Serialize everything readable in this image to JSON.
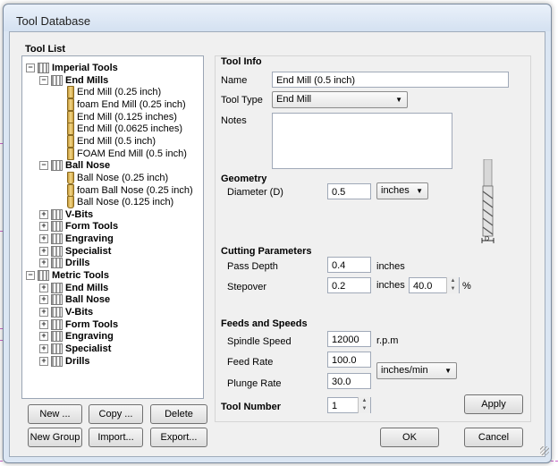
{
  "window": {
    "title": "Tool Database"
  },
  "tool_list": {
    "group_title": "Tool List",
    "tree": [
      {
        "label": "Imperial Tools",
        "level": 0,
        "kind": "folder",
        "expanded": true
      },
      {
        "label": "End Mills",
        "level": 1,
        "kind": "folder",
        "expanded": true
      },
      {
        "label": "End Mill (0.25 inch)",
        "level": 2,
        "kind": "tool"
      },
      {
        "label": "foam End Mill (0.25 inch)",
        "level": 2,
        "kind": "tool"
      },
      {
        "label": "End Mill (0.125 inches)",
        "level": 2,
        "kind": "tool"
      },
      {
        "label": "End Mill (0.0625 inches)",
        "level": 2,
        "kind": "tool"
      },
      {
        "label": "End Mill (0.5 inch)",
        "level": 2,
        "kind": "tool"
      },
      {
        "label": "FOAM End Mill (0.5 inch)",
        "level": 2,
        "kind": "tool"
      },
      {
        "label": "Ball Nose",
        "level": 1,
        "kind": "folder",
        "expanded": true
      },
      {
        "label": "Ball Nose (0.25 inch)",
        "level": 2,
        "kind": "ball"
      },
      {
        "label": "foam Ball Nose (0.25 inch)",
        "level": 2,
        "kind": "ball"
      },
      {
        "label": "Ball Nose (0.125 inch)",
        "level": 2,
        "kind": "ball"
      },
      {
        "label": "V-Bits",
        "level": 1,
        "kind": "folder",
        "expanded": false
      },
      {
        "label": "Form Tools",
        "level": 1,
        "kind": "folder",
        "expanded": false
      },
      {
        "label": "Engraving",
        "level": 1,
        "kind": "folder",
        "expanded": false
      },
      {
        "label": "Specialist",
        "level": 1,
        "kind": "folder",
        "expanded": false
      },
      {
        "label": "Drills",
        "level": 1,
        "kind": "folder",
        "expanded": false
      },
      {
        "label": "Metric Tools",
        "level": 0,
        "kind": "folder",
        "expanded": true
      },
      {
        "label": "End Mills",
        "level": 1,
        "kind": "folder",
        "expanded": false
      },
      {
        "label": "Ball Nose",
        "level": 1,
        "kind": "folder",
        "expanded": false
      },
      {
        "label": "V-Bits",
        "level": 1,
        "kind": "folder",
        "expanded": false
      },
      {
        "label": "Form Tools",
        "level": 1,
        "kind": "folder",
        "expanded": false
      },
      {
        "label": "Engraving",
        "level": 1,
        "kind": "folder",
        "expanded": false
      },
      {
        "label": "Specialist",
        "level": 1,
        "kind": "folder",
        "expanded": false
      },
      {
        "label": "Drills",
        "level": 1,
        "kind": "folder",
        "expanded": false
      }
    ],
    "buttons": {
      "new": "New ...",
      "copy": "Copy ...",
      "delete": "Delete",
      "new_group": "New Group",
      "import": "Import...",
      "export": "Export..."
    }
  },
  "tool_info": {
    "section_title": "Tool Info",
    "name_label": "Name",
    "name_value": "End Mill (0.5 inch)",
    "tool_type_label": "Tool Type",
    "tool_type_value": "End Mill",
    "notes_label": "Notes",
    "notes_value": ""
  },
  "geometry": {
    "section_title": "Geometry",
    "diameter_label": "Diameter (D)",
    "diameter_value": "0.5",
    "units_value": "inches",
    "diagram_label": "D"
  },
  "cutting": {
    "section_title": "Cutting Parameters",
    "pass_depth_label": "Pass Depth",
    "pass_depth_value": "0.4",
    "pass_depth_unit": "inches",
    "stepover_label": "Stepover",
    "stepover_value": "0.2",
    "stepover_unit": "inches",
    "stepover_percent": "40.0",
    "percent_sign": "%"
  },
  "feeds": {
    "section_title": "Feeds and Speeds",
    "spindle_label": "Spindle Speed",
    "spindle_value": "12000",
    "spindle_unit": "r.p.m",
    "feed_label": "Feed Rate",
    "feed_value": "100.0",
    "plunge_label": "Plunge Rate",
    "plunge_value": "30.0",
    "rate_units_value": "inches/min"
  },
  "tool_number": {
    "label": "Tool Number",
    "value": "1"
  },
  "actions": {
    "apply": "Apply",
    "ok": "OK",
    "cancel": "Cancel"
  }
}
